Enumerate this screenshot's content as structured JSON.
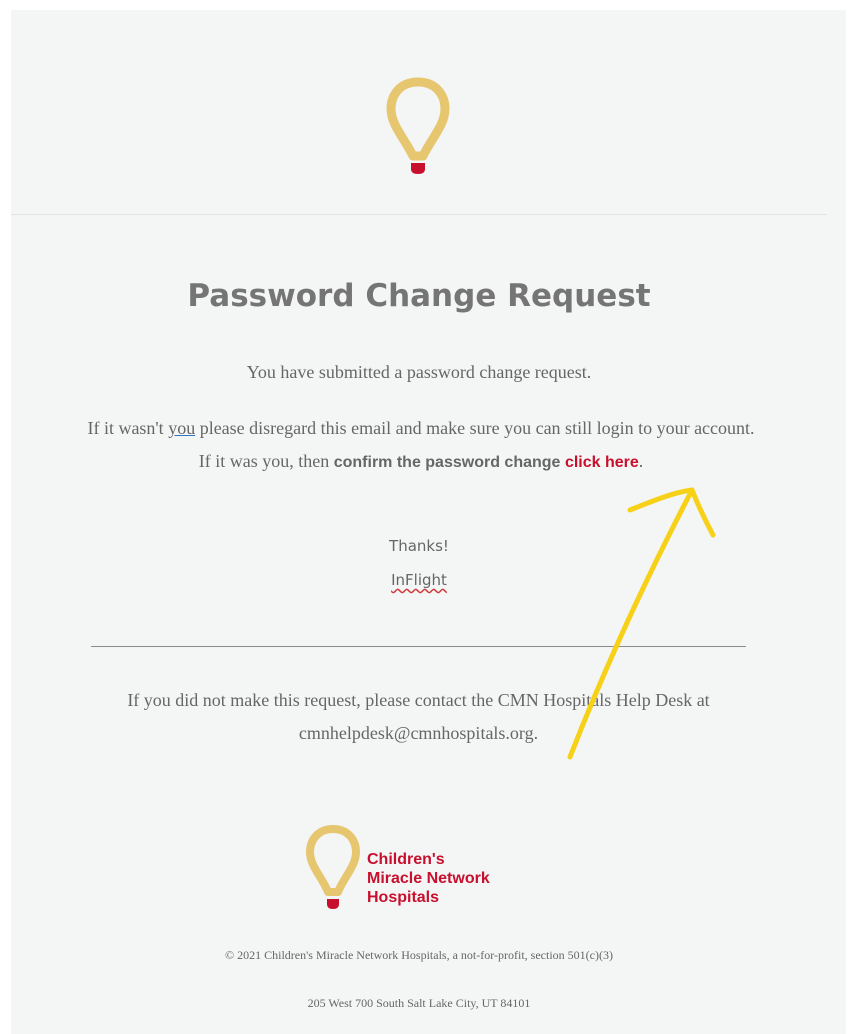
{
  "email": {
    "title": "Password Change Request",
    "intro": "You have submitted a password change request.",
    "para_part1": "If it wasn't ",
    "para_you": "you",
    "para_part2": " please disregard this email and make sure you can still login to your account. If it was you, then ",
    "para_bold": "confirm the password change",
    "para_space": " ",
    "link_label": "click here",
    "para_end": ".",
    "thanks": "Thanks!",
    "signature": "InFlight",
    "help_text": "If you did not make this request, please contact the CMN Hospitals Help Desk at cmnhelpdesk@cmnhospitals.org."
  },
  "footer": {
    "logo_line1": "Children's",
    "logo_line2": "Miracle Network",
    "logo_line3": "Hospitals",
    "copyright": "© 2021 Children's Miracle Network Hospitals, a not-for-profit, section 501(c)(3)",
    "address": "205 West 700 South Salt Lake City, UT 84101"
  },
  "icons": {
    "header_logo": "balloon-logo-icon",
    "footer_logo": "cmn-balloon-icon",
    "annotation": "yellow-arrow-annotation"
  },
  "colors": {
    "background": "#f4f5f5",
    "balloon_gold": "#e6c770",
    "balloon_red": "#c8102e",
    "link_red": "#c8102e",
    "text_gray": "#666666",
    "annotation_yellow": "#f7d117"
  }
}
